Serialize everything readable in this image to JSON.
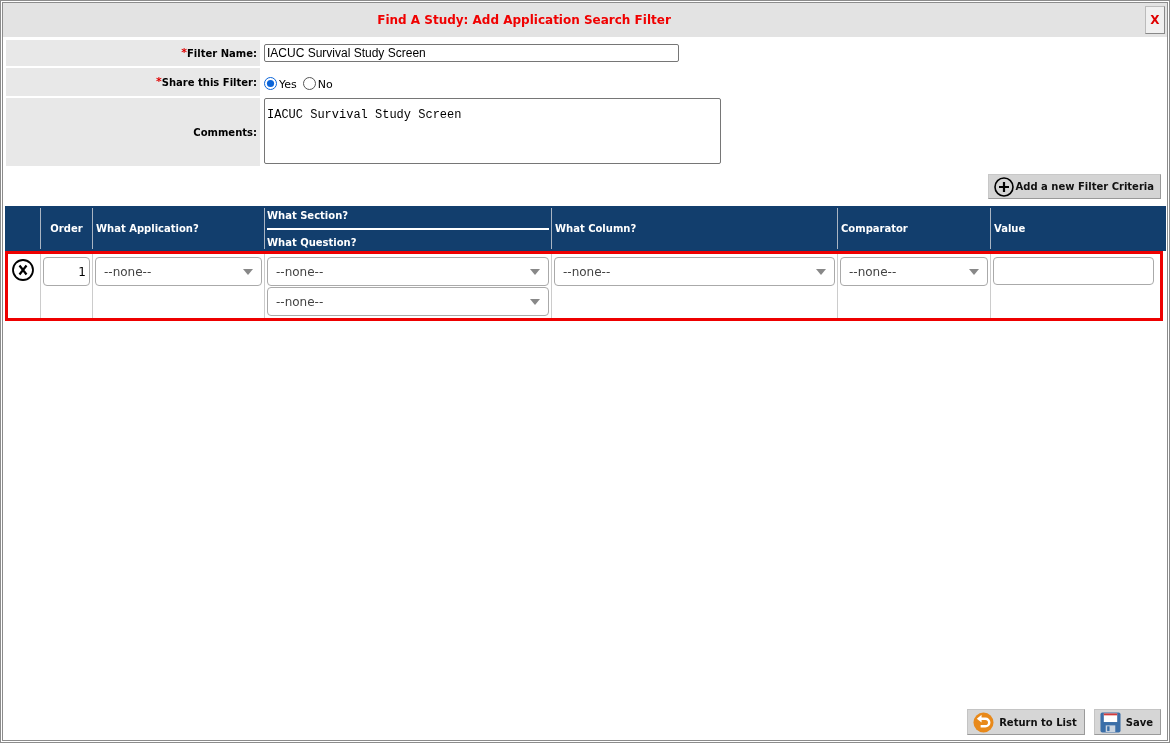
{
  "dialog": {
    "title": "Find A Study: Add Application Search Filter",
    "close_button": "X"
  },
  "form": {
    "fields": [
      {
        "kind": "text",
        "required_mark": "*",
        "label": "Filter Name:",
        "value": "IACUC Survival Study Screen"
      },
      {
        "kind": "radio",
        "required_mark": "*",
        "label": "Share this Filter:",
        "options": [
          {
            "label": "Yes",
            "selected": true
          },
          {
            "label": "No",
            "selected": false
          }
        ]
      },
      {
        "kind": "textarea",
        "label": "Comments:",
        "value": "IACUC Survival Study Screen"
      }
    ]
  },
  "add_criteria_button": "Add a new Filter Criteria",
  "criteria_table": {
    "columns": [
      {
        "kind": "single",
        "label": "Order"
      },
      {
        "kind": "single",
        "label": "What Application?"
      },
      {
        "kind": "stacked",
        "labels": [
          "What Section?",
          "What Question?"
        ]
      },
      {
        "kind": "single",
        "label": "What Column?"
      },
      {
        "kind": "single",
        "label": "Comparator"
      },
      {
        "kind": "single",
        "label": "Value"
      }
    ],
    "rows": [
      {
        "highlighted": true,
        "order": "1",
        "application": "--none--",
        "section": "--none--",
        "question": "--none--",
        "column": "--none--",
        "comparator": "--none--"
      }
    ]
  },
  "footer_buttons": [
    {
      "kind": "return",
      "label": "Return to List"
    },
    {
      "kind": "save",
      "label": "Save"
    }
  ]
}
